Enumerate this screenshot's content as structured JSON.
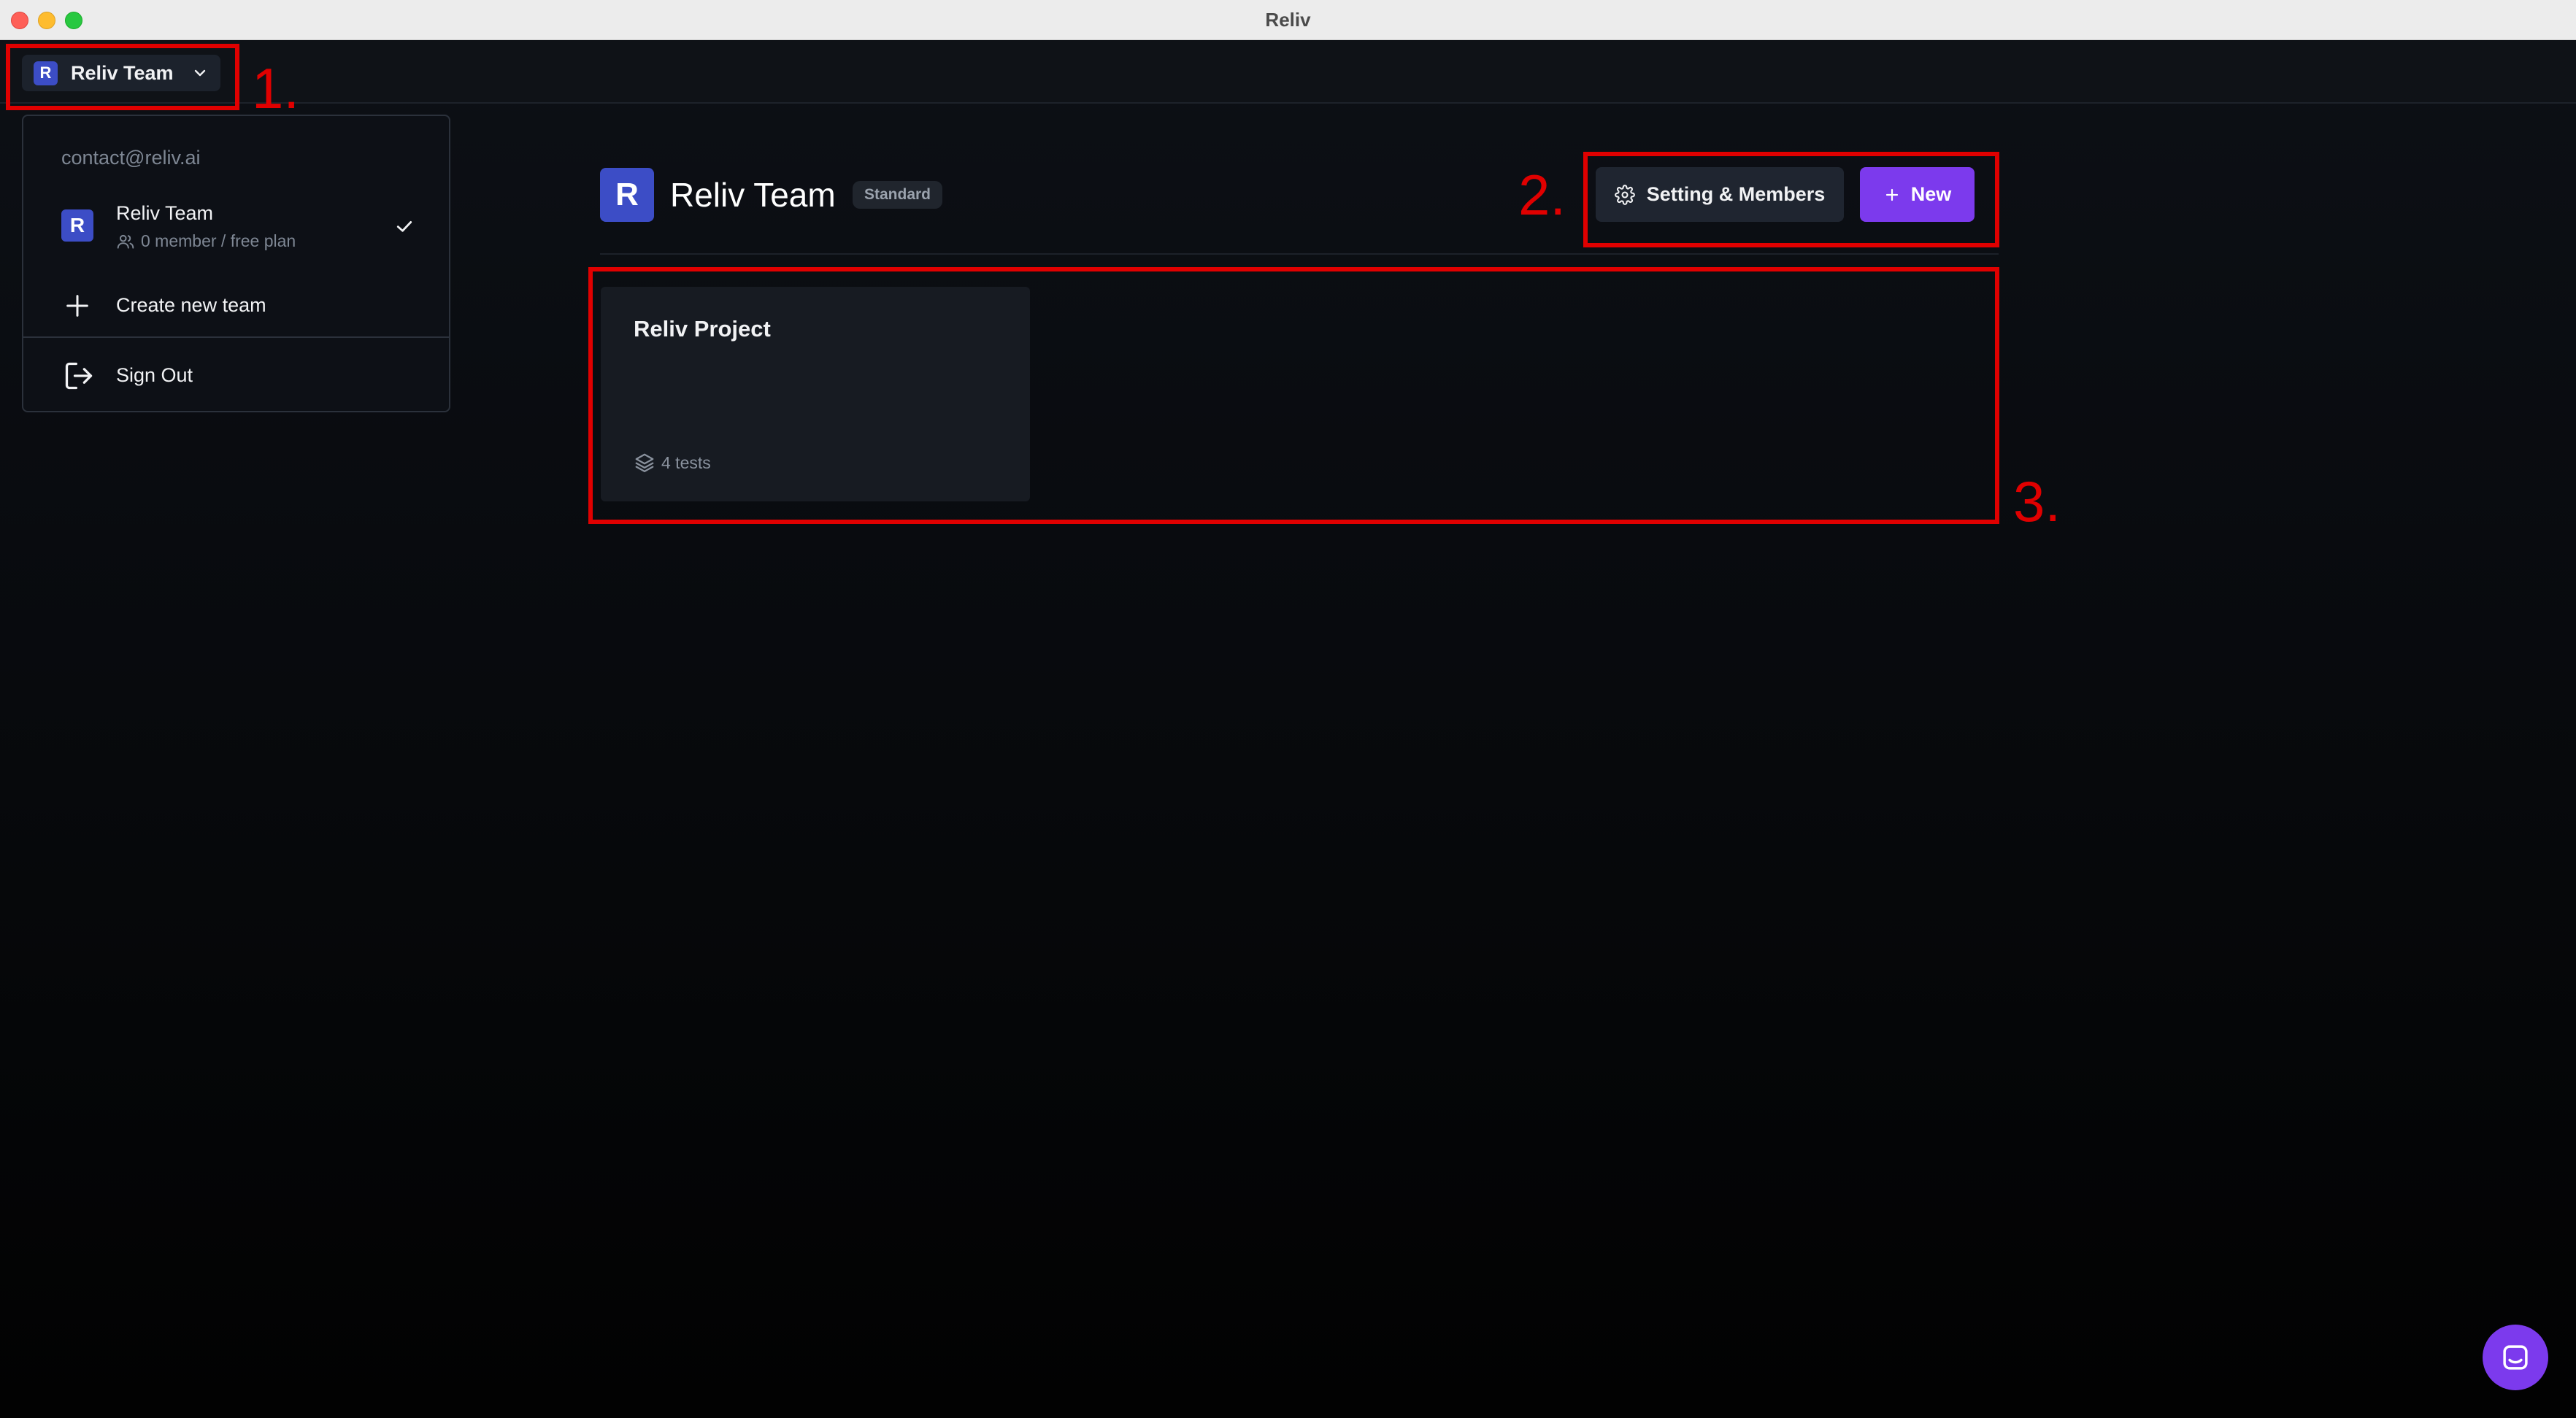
{
  "window": {
    "title": "Reliv"
  },
  "topbar": {
    "team_switcher": {
      "avatar_letter": "R",
      "label": "Reliv Team",
      "icon": "chevron-down-icon"
    }
  },
  "dropdown": {
    "email": "contact@reliv.ai",
    "team": {
      "avatar_letter": "R",
      "name": "Reliv Team",
      "subtitle": "0 member / free plan",
      "selected_icon": "checkmark-icon"
    },
    "create_label": "Create new team",
    "signout_label": "Sign Out"
  },
  "header": {
    "avatar_letter": "R",
    "title": "Reliv Team",
    "plan_badge": "Standard",
    "settings_label": "Setting & Members",
    "new_label": "New"
  },
  "projects": [
    {
      "title": "Reliv Project",
      "tests": "4 tests"
    }
  ],
  "annotations": {
    "labels": [
      "1.",
      "2.",
      "3."
    ],
    "color": "#e00000"
  },
  "colors": {
    "accent": "#7c3aed",
    "avatar": "#3c4dc6",
    "background": "#0d1016"
  }
}
